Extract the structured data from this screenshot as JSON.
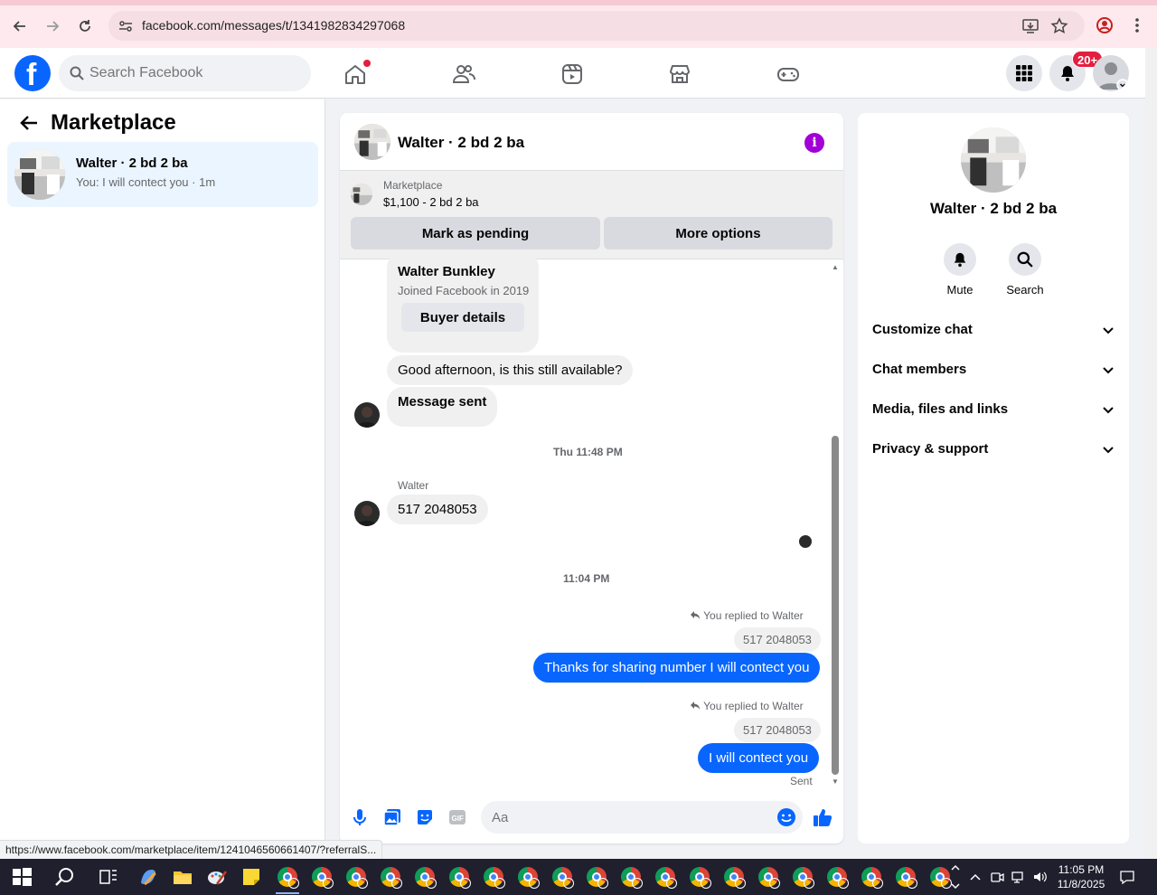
{
  "browser": {
    "url": "facebook.com/messages/t/1341982834297068",
    "status_url": "https://www.facebook.com/marketplace/item/1241046560661407/?referralS..."
  },
  "header": {
    "search_placeholder": "Search Facebook",
    "notification_badge": "20+"
  },
  "sidebar": {
    "title": "Marketplace",
    "conversations": [
      {
        "name": "Walter · 2 bd 2 ba",
        "preview": "You: I will contect you · 1m"
      }
    ]
  },
  "chat": {
    "title": "Walter · 2 bd 2 ba",
    "marketplace": {
      "label": "Marketplace",
      "price": "$1,100 - 2 bd 2 ba",
      "mark_pending": "Mark as pending",
      "more_options": "More options"
    },
    "card": {
      "name": "Walter Bunkley",
      "joined": "Joined Facebook in 2019",
      "button": "Buyer details"
    },
    "messages": {
      "m1": "Good afternoon, is this still available?",
      "m2": "Message sent",
      "ts1": "Thu 11:48 PM",
      "sender": "Walter",
      "m3": "517 2048053",
      "ts2": "11:04 PM",
      "reply_label_1": "You replied to Walter",
      "quote_1": "517 2048053",
      "m4": "Thanks for sharing number I will contect you",
      "reply_label_2": "You replied to Walter",
      "quote_2": "517 2048053",
      "m5": "I will contect you",
      "status": "Sent"
    },
    "composer_placeholder": "Aa"
  },
  "details": {
    "title": "Walter · 2 bd 2 ba",
    "actions": [
      "Mute",
      "Search"
    ],
    "sections": [
      "Customize chat",
      "Chat members",
      "Media, files and links",
      "Privacy & support"
    ]
  },
  "taskbar": {
    "time": "11:05 PM",
    "date": "11/8/2025"
  },
  "colors": {
    "fb_blue": "#0866ff",
    "info_purple": "#a100d6",
    "badge_red": "#e41e3f"
  }
}
